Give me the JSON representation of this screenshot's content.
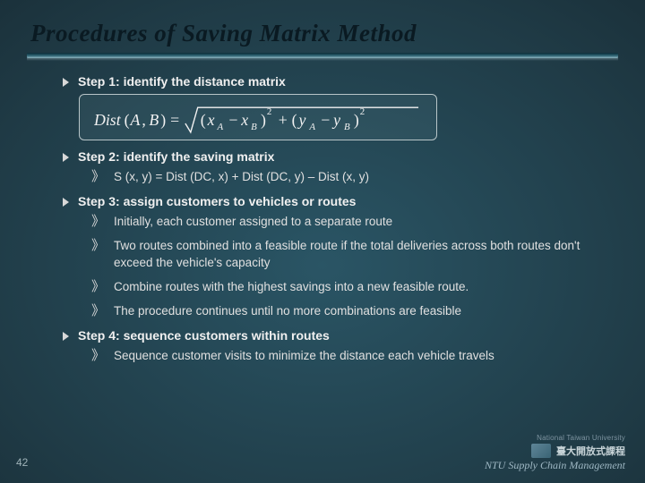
{
  "title": "Procedures of Saving Matrix Method",
  "steps": {
    "s1": {
      "head": "Step 1: identify the distance matrix"
    },
    "s2": {
      "head": "Step 2: identify the saving matrix",
      "sub1": "S (x, y) = Dist (DC, x) + Dist (DC, y) – Dist (x, y)"
    },
    "s3": {
      "head": "Step 3: assign customers to vehicles or routes",
      "sub1": "Initially, each customer assigned to a separate route",
      "sub2": "Two routes combined into a feasible route if the total deliveries across both routes don't exceed the vehicle's capacity",
      "sub3": "Combine routes with the highest savings into a new feasible route.",
      "sub4": "The procedure continues until no more combinations are feasible"
    },
    "s4": {
      "head": "Step 4: sequence customers within routes",
      "sub1": "Sequence customer visits to minimize the distance each vehicle travels"
    }
  },
  "formula_alt": "Dist(A, B) = sqrt((x_A - x_B)^2 + (y_A - y_B)^2)",
  "page_number": "42",
  "brand": {
    "top": "National Taiwan University",
    "cn": "臺大開放式課程",
    "sub": "NTU Supply Chain Management"
  }
}
